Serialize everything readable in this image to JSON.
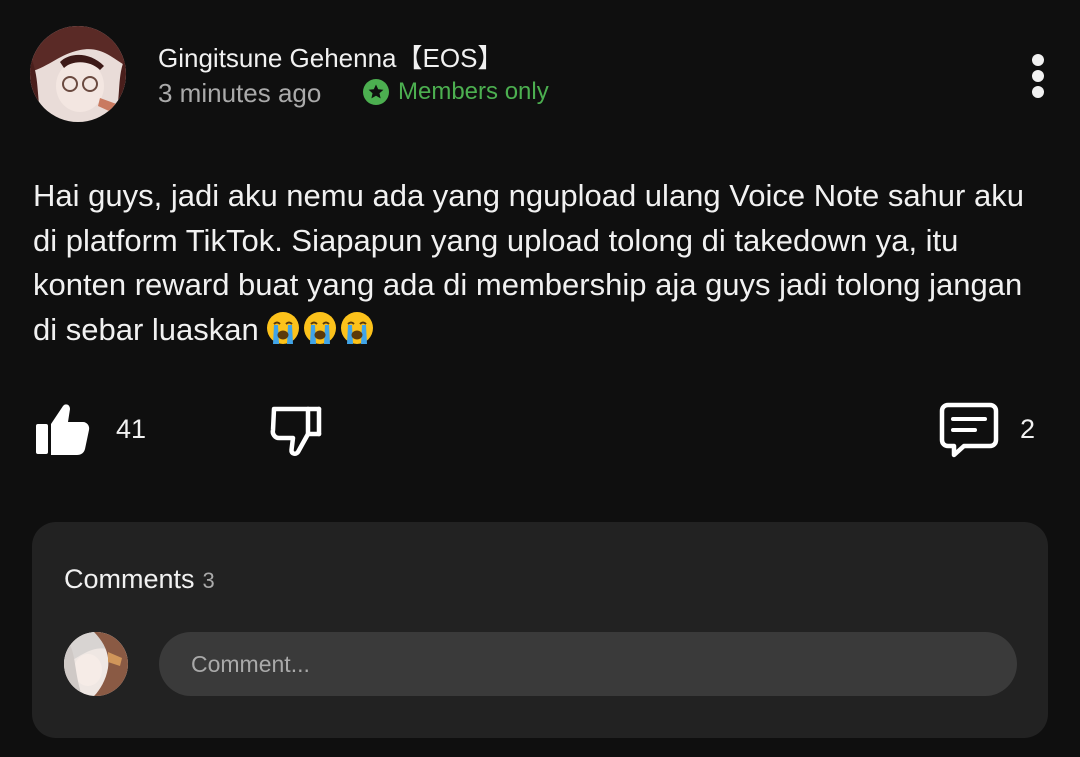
{
  "post": {
    "author": "Gingitsune Gehenna【EOS】",
    "time": "3 minutes ago",
    "badge": "Members only",
    "body": "Hai guys, jadi aku nemu ada yang ngupload ulang Voice Note sahur aku di platform TikTok. Siapapun yang upload tolong di takedown ya, itu konten reward buat yang ada di membership aja guys jadi tolong jangan di sebar luaskan",
    "emoji_icons": [
      "loudly-crying-face-icon",
      "loudly-crying-face-icon",
      "loudly-crying-face-icon"
    ]
  },
  "actions": {
    "like_count": "41",
    "comment_count": "2"
  },
  "comments": {
    "heading": "Comments",
    "count": "3",
    "placeholder": "Comment..."
  },
  "colors": {
    "background": "#0f0f0f",
    "panel": "#222222",
    "input": "#3a3a3a",
    "members_green": "#4caf50",
    "secondary_text": "#aaaaaa"
  }
}
